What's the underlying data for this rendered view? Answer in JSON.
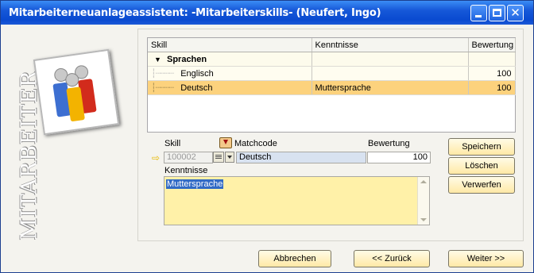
{
  "window": {
    "title": "Mitarbeiterneuanlageassistent:  -Mitarbeiterskills- (Neufert, Ingo)"
  },
  "sidebar": {
    "watermark": "MITARBEITER",
    "logo_icon": "people-group-icon"
  },
  "grid": {
    "columns": [
      "Skill",
      "Kenntnisse",
      "Bewertung"
    ],
    "group": {
      "label": "Sprachen",
      "icon": "expand-triangle-icon"
    },
    "rows": [
      {
        "skill": "Englisch",
        "kenntnisse": "",
        "bewertung": "100"
      },
      {
        "skill": "Deutsch",
        "kenntnisse": "Muttersprache",
        "bewertung": "100"
      }
    ]
  },
  "form": {
    "skill_label": "Skill",
    "matchcode_label": "Matchcode",
    "bewertung_label": "Bewertung",
    "kenntnisse_label": "Kenntnisse",
    "skill_value": "100002",
    "matchcode_value": "Deutsch",
    "bewertung_value": "100",
    "kenntnisse_value": "Muttersprache"
  },
  "actions": {
    "speichern": "Speichern",
    "loeschen": "Löschen",
    "verwerfen": "Verwerfen"
  },
  "footer": {
    "abbrechen": "Abbrechen",
    "zurueck": "<< Zurück",
    "weiter": "Weiter >>"
  },
  "colors": {
    "title_bar": "#0a4ad0",
    "selection": "#fcd27d",
    "text_area": "#fff1a8",
    "button": "#ffe9a6"
  }
}
